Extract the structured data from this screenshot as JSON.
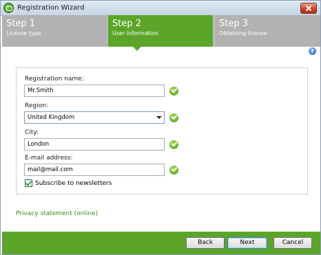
{
  "window": {
    "title": "Registration Wizard"
  },
  "steps": [
    {
      "number": "Step 1",
      "label": "License type"
    },
    {
      "number": "Step 2",
      "label": "User information"
    },
    {
      "number": "Step 3",
      "label": "Obtaining license"
    }
  ],
  "form": {
    "registration_name": {
      "label": "Registration name:",
      "value": "Mr.Smith"
    },
    "region": {
      "label": "Region:",
      "value": "United Kingdom"
    },
    "city": {
      "label": "City:",
      "value": "London"
    },
    "email": {
      "label": "E-mail address:",
      "value": "mail@mail.com"
    },
    "newsletter": {
      "label": "Subscribe to newsletters",
      "checked": true
    }
  },
  "privacy_link": "Privacy statement (online)",
  "buttons": {
    "back": "Back",
    "next": "Next",
    "cancel": "Cancel"
  },
  "colors": {
    "accent": "#5ba62a",
    "inactive_step": "#b2b2b2"
  },
  "icons": {
    "app": "app-logo-icon",
    "help": "help-icon",
    "valid": "check-ok-icon"
  }
}
